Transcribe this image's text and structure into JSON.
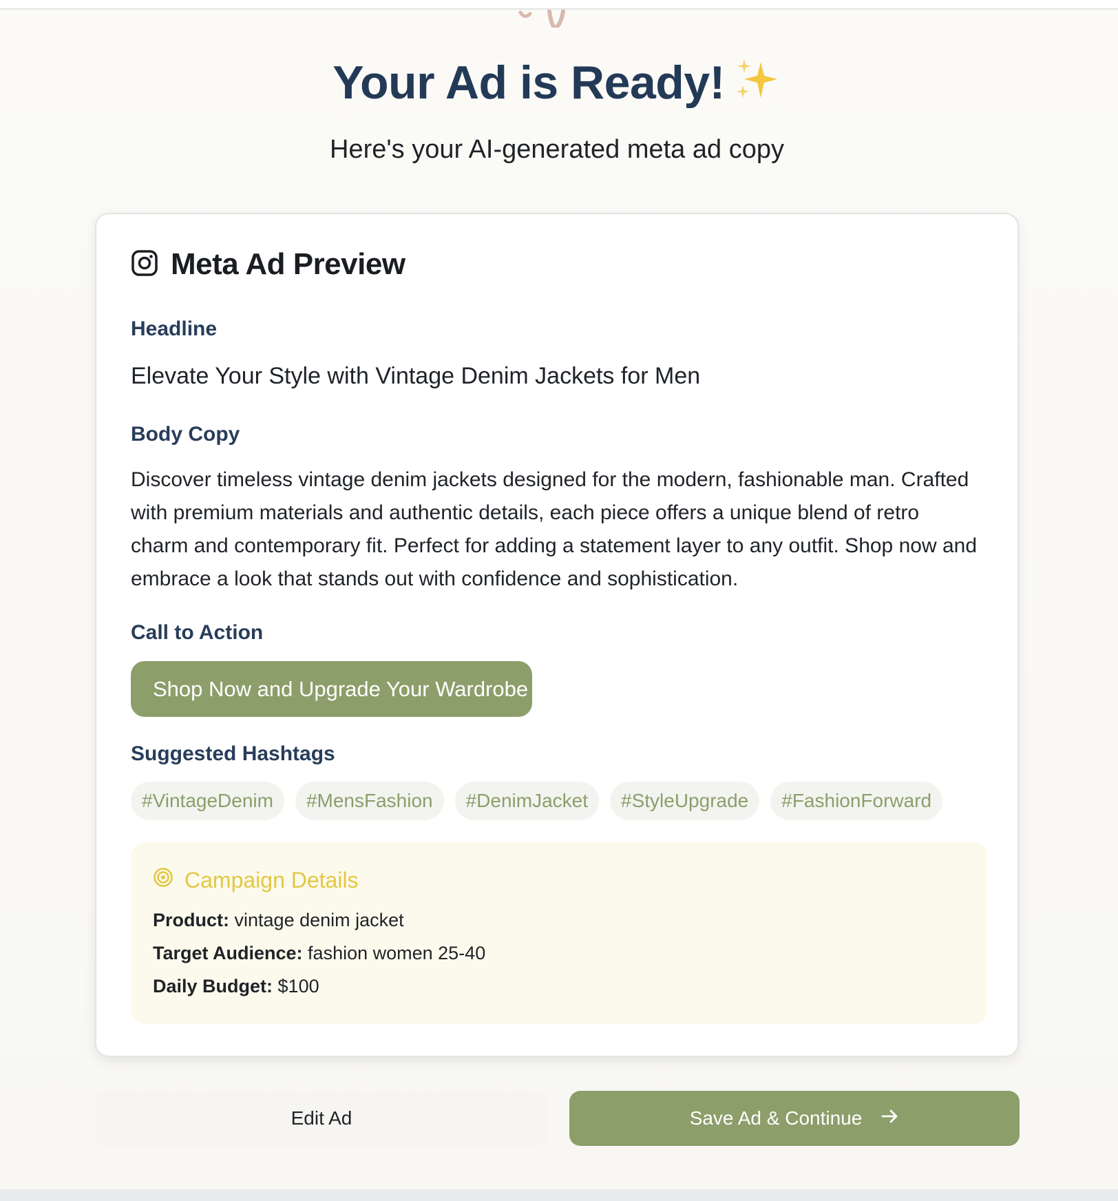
{
  "header": {
    "title": "Your Ad is Ready!",
    "sparkle_icon": "sparkles-icon",
    "subtitle": "Here's your AI-generated meta ad copy"
  },
  "preview": {
    "title": "Meta Ad Preview",
    "title_icon": "instagram-icon",
    "headline_label": "Headline",
    "headline": "Elevate Your Style with Vintage Denim Jackets for Men",
    "body_label": "Body Copy",
    "body_lines": [
      "Discover timeless vintage denim jackets designed for the modern, fashionable man. Crafted",
      "with premium materials and authentic details, each piece offers a unique blend of retro",
      "charm and contemporary fit. Perfect for adding a statement layer to any outfit. Shop now and",
      "embrace a look that stands out with confidence and sophistication."
    ],
    "cta_label": "Call to Action",
    "cta_text": "Shop Now and Upgrade Your Wardrobe",
    "hashtags_label": "Suggested Hashtags",
    "hashtags": [
      "#VintageDenim",
      "#MensFashion",
      "#DenimJacket",
      "#StyleUpgrade",
      "#FashionForward"
    ]
  },
  "campaign": {
    "title": "Campaign Details",
    "title_icon": "target-icon",
    "product_label": "Product:",
    "product_value": "vintage denim jacket",
    "audience_label": "Target Audience:",
    "audience_value": "fashion women 25-40",
    "budget_label": "Daily Budget:",
    "budget_value": "$100"
  },
  "actions": {
    "edit_label": "Edit Ad",
    "save_label": "Save Ad & Continue",
    "save_icon": "arrow-right-icon"
  },
  "colors": {
    "accent_green": "#8c9e6a",
    "title_navy": "#233a57",
    "campaign_yellow": "#e3c744",
    "campaign_bg": "#fcfaec"
  }
}
